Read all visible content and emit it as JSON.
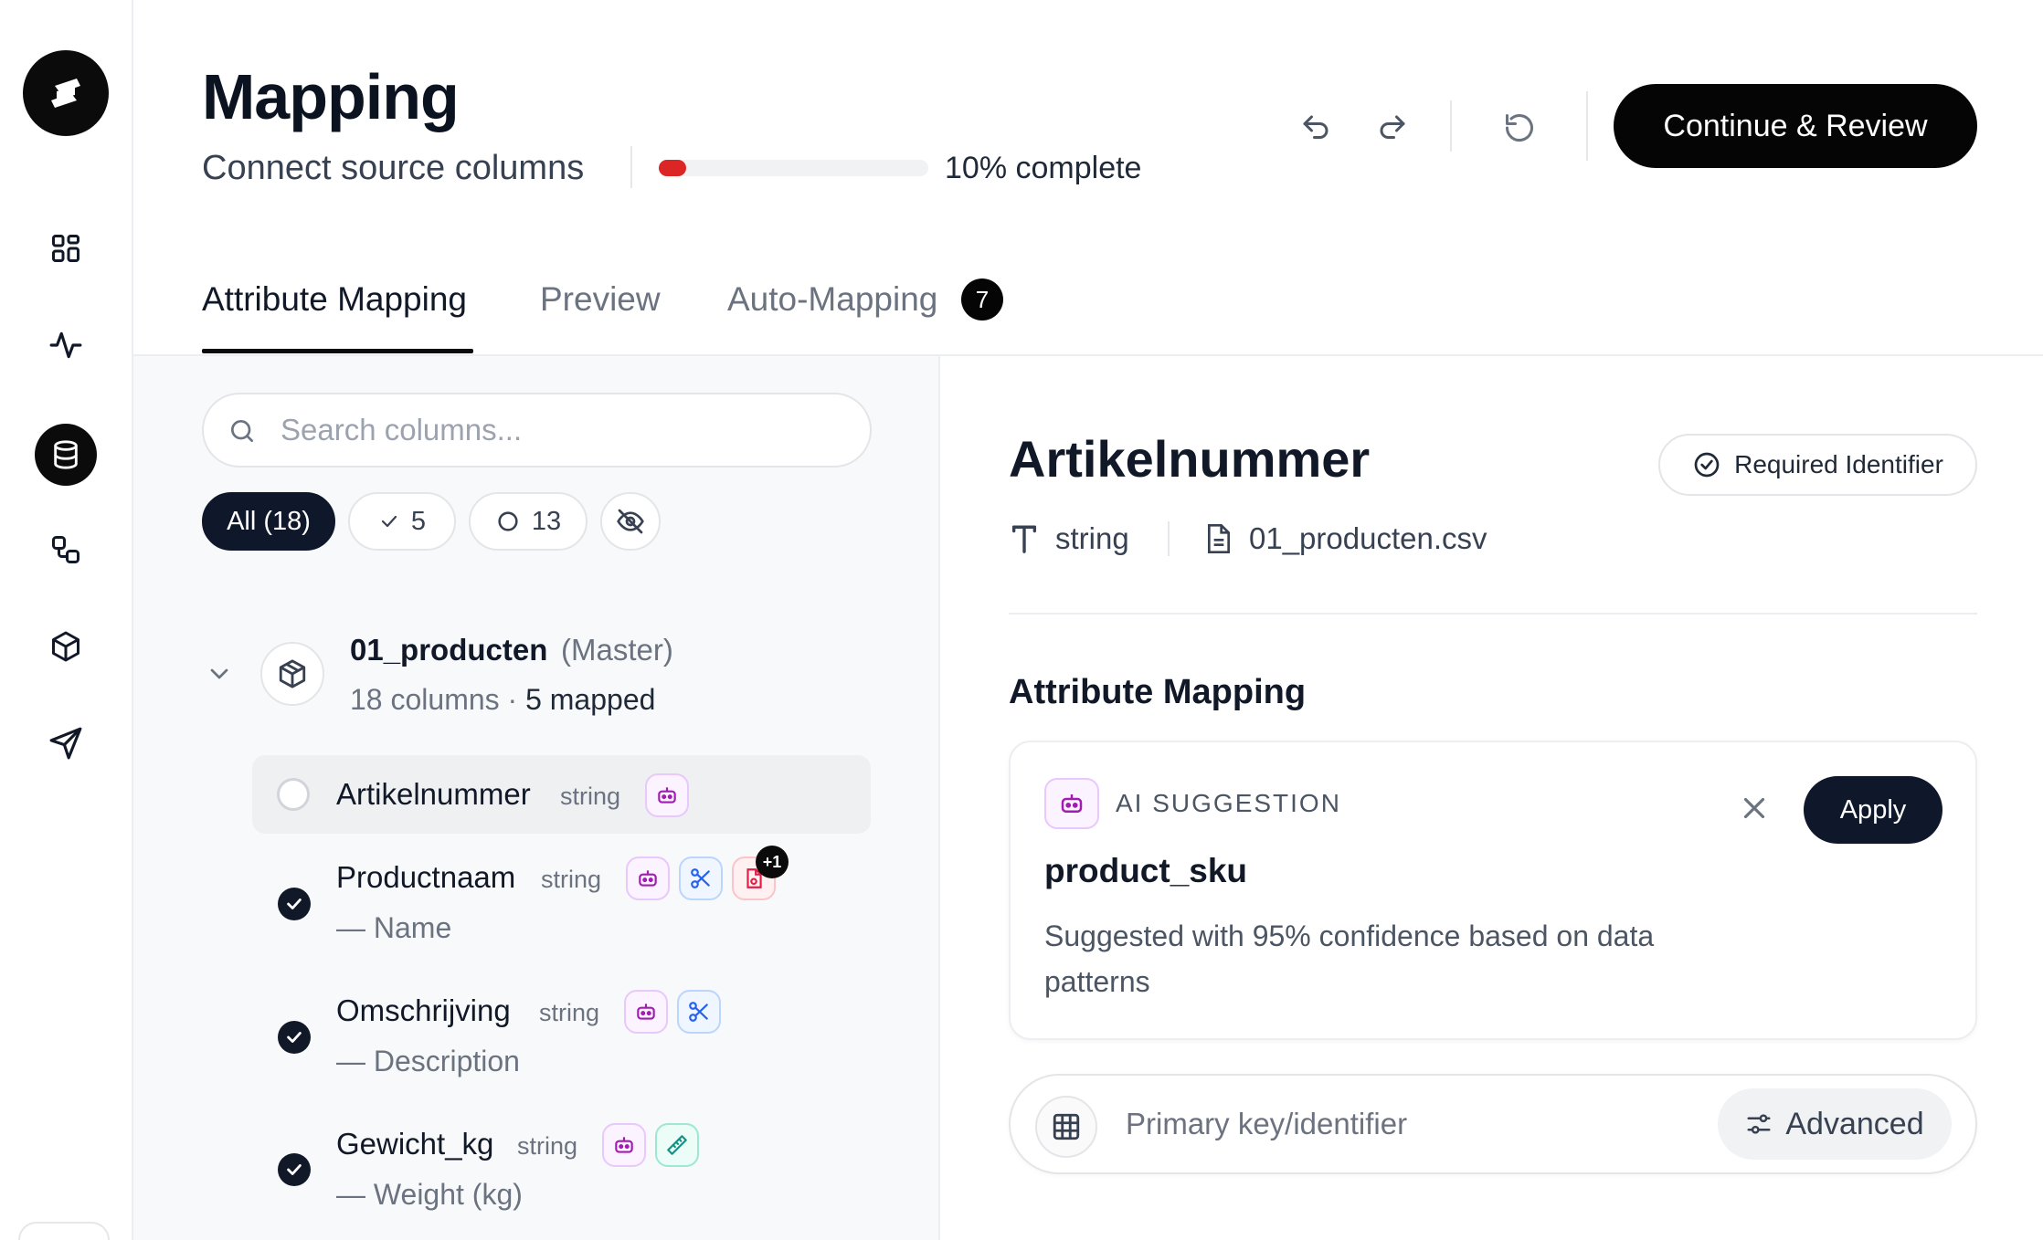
{
  "header": {
    "title": "Mapping",
    "subtitle": "Connect source columns",
    "progress_percent": 10,
    "progress_label": "10% complete",
    "continue_label": "Continue & Review"
  },
  "tabs": [
    {
      "label": "Attribute Mapping",
      "active": true
    },
    {
      "label": "Preview",
      "active": false
    },
    {
      "label": "Auto-Mapping",
      "active": false,
      "badge": "7"
    }
  ],
  "left": {
    "search_placeholder": "Search columns...",
    "filters": {
      "all": "All (18)",
      "mapped": "5",
      "unmapped": "13"
    },
    "group": {
      "name": "01_producten",
      "tag": "(Master)",
      "columns_text": "18 columns ·",
      "mapped_text": "5 mapped"
    },
    "columns": [
      {
        "name": "Artikelnummer",
        "type": "string",
        "mapped_to": ""
      },
      {
        "name": "Productnaam",
        "type": "string",
        "mapped_to": "— Name",
        "extra_badge": "+1"
      },
      {
        "name": "Omschrijving",
        "type": "string",
        "mapped_to": "— Description"
      },
      {
        "name": "Gewicht_kg",
        "type": "string",
        "mapped_to": "— Weight (kg)"
      }
    ]
  },
  "detail": {
    "title": "Artikelnummer",
    "required_badge": "Required Identifier",
    "type": "string",
    "source_file": "01_producten.csv",
    "section_title": "Attribute Mapping",
    "suggestion": {
      "label": "AI SUGGESTION",
      "value": "product_sku",
      "description": "Suggested with 95% confidence based on data patterns",
      "apply_label": "Apply"
    },
    "target_placeholder": "Primary key/identifier",
    "advanced_label": "Advanced"
  },
  "colors": {
    "accent": "#0b0b0c",
    "progress": "#dc2626",
    "ai_badge": "#a21caf",
    "transform_badge": "#2563eb",
    "file_badge": "#e11d48",
    "measure_badge": "#0d9488"
  }
}
